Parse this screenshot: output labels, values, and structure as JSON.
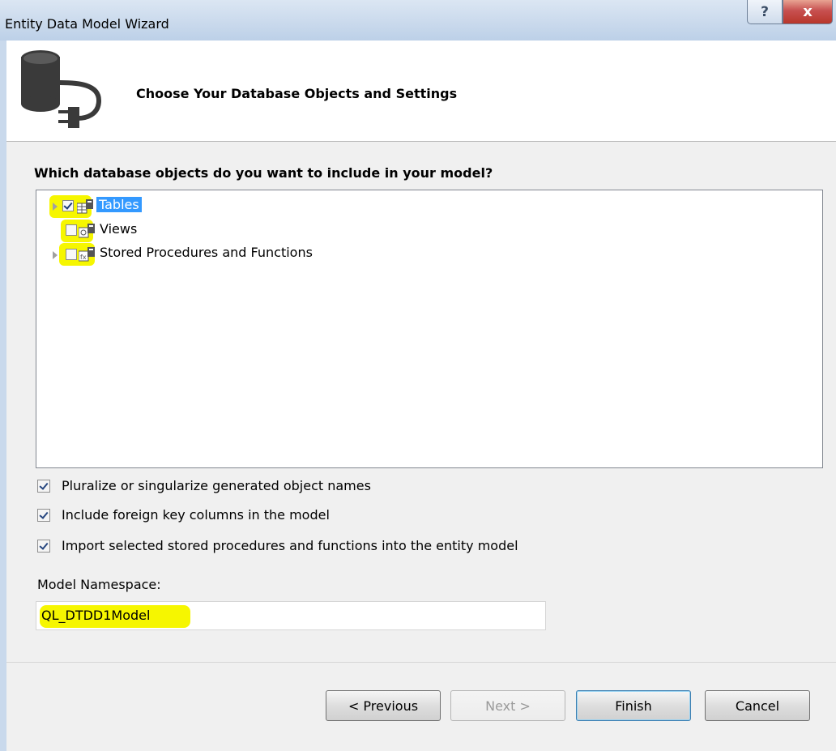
{
  "window": {
    "title": "Entity Data Model Wizard",
    "help_glyph": "?",
    "close_glyph": "x"
  },
  "header": {
    "title": "Choose Your Database Objects and Settings",
    "icon": "database-connect-icon"
  },
  "question": "Which database objects do you want to include in your model?",
  "tree": {
    "items": [
      {
        "label": "Tables",
        "checked": true,
        "expandable": true,
        "selected": true,
        "highlighted": true,
        "icon": "table-icon"
      },
      {
        "label": "Views",
        "checked": false,
        "expandable": false,
        "selected": false,
        "highlighted": true,
        "icon": "view-icon"
      },
      {
        "label": "Stored Procedures and Functions",
        "checked": false,
        "expandable": true,
        "selected": false,
        "highlighted": true,
        "icon": "procedure-icon"
      }
    ]
  },
  "options": [
    {
      "label": "Pluralize or singularize generated object names",
      "checked": true
    },
    {
      "label": "Include foreign key columns in the model",
      "checked": true
    },
    {
      "label": "Import selected stored procedures and functions into the entity model",
      "checked": true
    }
  ],
  "namespace": {
    "label": "Model Namespace:",
    "value": "QL_DTDD1Model"
  },
  "buttons": {
    "previous": "< Previous",
    "next": "Next >",
    "finish": "Finish",
    "cancel": "Cancel"
  },
  "colors": {
    "highlight": "#f6f600",
    "selection": "#3399ff"
  }
}
